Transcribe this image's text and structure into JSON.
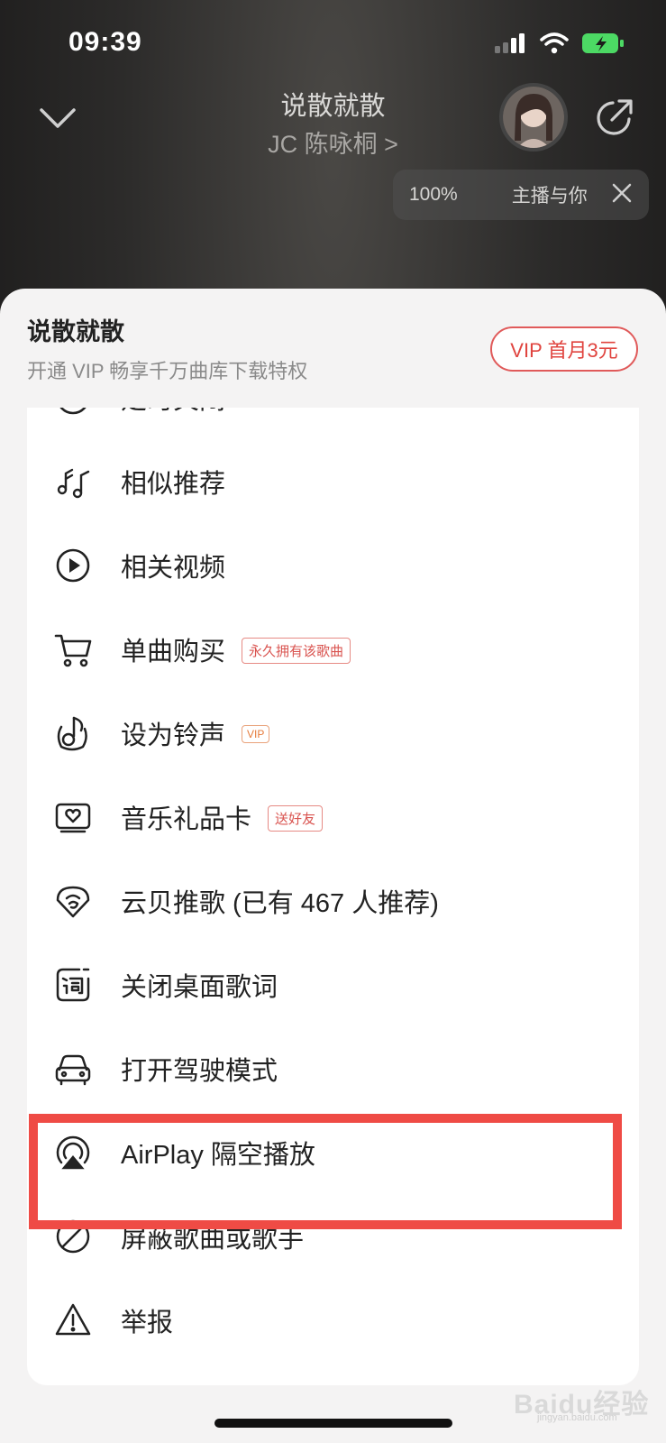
{
  "status": {
    "time": "09:39"
  },
  "header": {
    "song_title": "说散就散",
    "artist": "JC 陈咏桐 >",
    "pill_percent": "100%",
    "pill_text": "主播与你"
  },
  "sheet": {
    "title": "说散就散",
    "subtitle": "开通 VIP 畅享千万曲库下载特权",
    "vip_button": "VIP 首月3元",
    "partial_item": "定时关闭"
  },
  "menu": {
    "items": [
      {
        "label": "相似推荐",
        "icon": "music-notes-icon"
      },
      {
        "label": "相关视频",
        "icon": "play-video-icon"
      },
      {
        "label": "单曲购买",
        "icon": "shopping-cart-icon",
        "tag": "永久拥有该歌曲"
      },
      {
        "label": "设为铃声",
        "icon": "ringtone-icon",
        "tag": "VIP"
      },
      {
        "label": "音乐礼品卡",
        "icon": "gift-card-icon",
        "tag": "送好友"
      },
      {
        "label": "云贝推歌 (已有 467 人推荐)",
        "icon": "cloud-shell-icon"
      },
      {
        "label": "关闭桌面歌词",
        "icon": "lyrics-icon"
      },
      {
        "label": "打开驾驶模式",
        "icon": "car-icon"
      },
      {
        "label": "AirPlay 隔空播放",
        "icon": "airplay-icon"
      },
      {
        "label": "屏蔽歌曲或歌手",
        "icon": "block-icon"
      },
      {
        "label": "举报",
        "icon": "warning-icon"
      }
    ]
  },
  "colors": {
    "accent": "#e0443f",
    "highlight": "#ef4b45"
  },
  "watermark": {
    "main": "Baidu经验",
    "sub": "jingyan.baidu.com"
  }
}
